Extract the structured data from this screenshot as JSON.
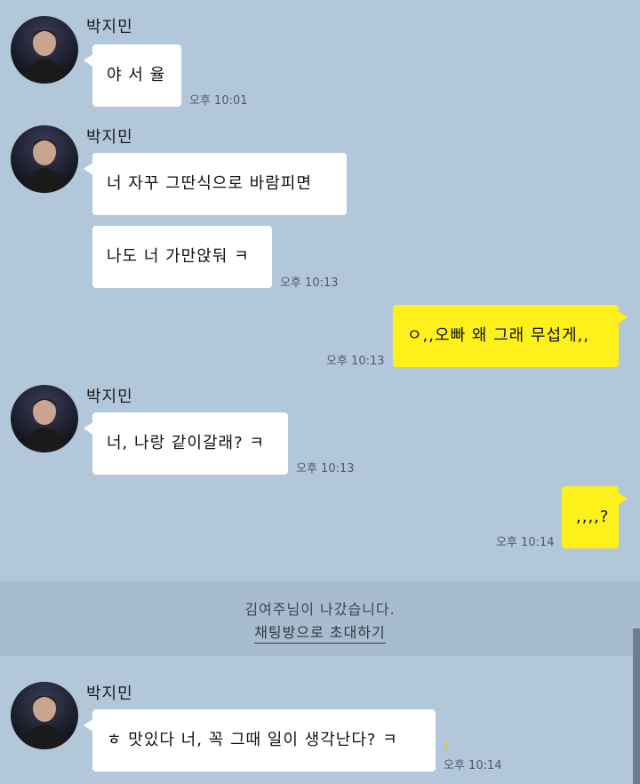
{
  "messages": [
    {
      "sender": "박지민",
      "text": "야 서 율",
      "time": "오후 10:01"
    },
    {
      "sender": "박지민",
      "text": "너 자꾸 그딴식으로 바람피면"
    },
    {
      "text": "나도 너 가만앉둬 ㅋ",
      "time": "오후 10:13"
    },
    {
      "text": "ㅇ,,오빠 왜 그래 무섭게,,",
      "time": "오후 10:13",
      "mine": true
    },
    {
      "sender": "박지민",
      "text": "너, 나랑 같이갈래? ㅋ",
      "time": "오후 10:13"
    },
    {
      "text": ",,,,?",
      "time": "오후 10:14",
      "mine": true
    },
    {
      "sender": "박지민",
      "text": "ㅎ 맛있다 너, 꼭 그때 일이 생각난다? ㅋ",
      "time": "오후 10:14",
      "unread": "1"
    }
  ],
  "notice": {
    "text": "김여주님이 나갔습니다.",
    "link": "채팅방으로 초대하기"
  }
}
